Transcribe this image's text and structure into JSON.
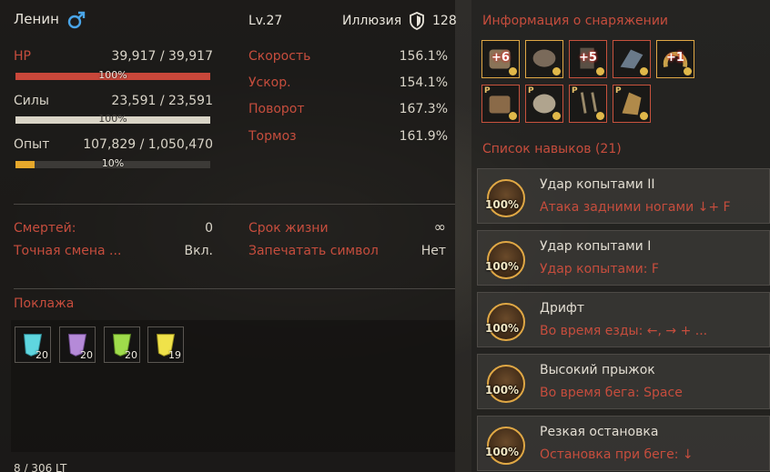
{
  "header": {
    "name": "Ленин",
    "gender_icon": "male-symbol-icon",
    "level": "Lv.27",
    "illusion_label": "Иллюзия",
    "illusion_value": "128",
    "illusion_icon": "shield-icon"
  },
  "stats": {
    "hp": {
      "label": "HP",
      "value": "39,917 / 39,917",
      "percent_text": "100%",
      "fill": 1.0,
      "color": "#c9473a"
    },
    "stamina": {
      "label": "Силы",
      "value": "23,591 / 23,591",
      "percent_text": "100%",
      "fill": 1.0,
      "color": "#d9d4c6"
    },
    "exp": {
      "label": "Опыт",
      "value": "107,829 / 1,050,470",
      "percent_text": "10%",
      "fill": 0.1,
      "color": "#e6a82b"
    }
  },
  "speed_stats": [
    {
      "label": "Скорость",
      "value": "156.1%"
    },
    {
      "label": "Ускор.",
      "value": "154.1%"
    },
    {
      "label": "Поворот",
      "value": "167.3%"
    },
    {
      "label": "Тормоз",
      "value": "161.9%"
    }
  ],
  "misc": {
    "deaths_label": "Смертей:",
    "deaths_value": "0",
    "lifespan_label": "Срок жизни",
    "lifespan_value": "∞",
    "precise_label": "Точная смена ...",
    "precise_value": "Вкл.",
    "seal_label": "Запечатать символ",
    "seal_value": "Нет"
  },
  "cargo": {
    "title": "Поклажа",
    "items": [
      {
        "icon": "blue-crystal-icon",
        "count": "20",
        "color": "#5fd6df"
      },
      {
        "icon": "purple-crystal-icon",
        "count": "20",
        "color": "#b58ad8"
      },
      {
        "icon": "green-crystal-icon",
        "count": "20",
        "color": "#9fdc4b"
      },
      {
        "icon": "yellow-crystal-icon",
        "count": "19",
        "color": "#f0e24a"
      }
    ],
    "weight": "8 / 306 LT"
  },
  "equipment": {
    "title": "Информация о снаряжении",
    "items": [
      {
        "icon": "horse-saddle-icon",
        "enhance": "+6",
        "badge": "",
        "border": "gold"
      },
      {
        "icon": "horse-armor-icon",
        "enhance": "",
        "badge": "",
        "border": "gold"
      },
      {
        "icon": "horse-stirrups-icon",
        "enhance": "+5",
        "badge": "",
        "border": "red"
      },
      {
        "icon": "horse-barding-icon",
        "enhance": "",
        "badge": "",
        "border": "red"
      },
      {
        "icon": "horseshoe-icon",
        "enhance": "+1",
        "badge": "",
        "border": "gold"
      },
      {
        "icon": "saddle-outfit-icon",
        "enhance": "",
        "badge": "P",
        "border": "red"
      },
      {
        "icon": "armor-outfit-icon",
        "enhance": "",
        "badge": "P",
        "border": "red"
      },
      {
        "icon": "stirrup-outfit-icon",
        "enhance": "",
        "badge": "P",
        "border": "red"
      },
      {
        "icon": "horse-head-outfit-icon",
        "enhance": "",
        "badge": "P",
        "border": "red"
      }
    ]
  },
  "skills": {
    "title": "Список навыков (21)",
    "items": [
      {
        "name": "Удар копытами II",
        "desc": "Атака задними ногами ↓+ F",
        "pct": "100%"
      },
      {
        "name": "Удар копытами I",
        "desc": "Удар копытами: F",
        "pct": "100%"
      },
      {
        "name": "Дрифт",
        "desc": "Во время езды: ←, → + ...",
        "pct": "100%"
      },
      {
        "name": "Высокий прыжок",
        "desc": "Во время бега: Space",
        "pct": "100%"
      },
      {
        "name": "Резкая остановка",
        "desc": "Остановка при беге: ↓",
        "pct": "100%"
      }
    ]
  }
}
